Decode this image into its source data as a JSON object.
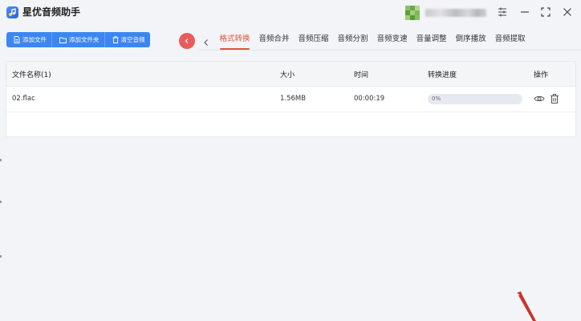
{
  "app": {
    "title": "星优音频助手"
  },
  "toolbar": {
    "add_file": "添加文件",
    "add_folder": "添加文件夹",
    "clear_audio": "清空音频"
  },
  "tabs": [
    {
      "label": "格式转换",
      "active": true
    },
    {
      "label": "音频合并",
      "active": false
    },
    {
      "label": "音频压缩",
      "active": false
    },
    {
      "label": "音频分割",
      "active": false
    },
    {
      "label": "音频变速",
      "active": false
    },
    {
      "label": "音量调整",
      "active": false
    },
    {
      "label": "倒序播放",
      "active": false
    },
    {
      "label": "音频提取",
      "active": false
    }
  ],
  "table": {
    "headers": {
      "name": "文件名称(1)",
      "size": "大小",
      "time": "时间",
      "progress": "转换进度",
      "actions": "操作"
    },
    "rows": [
      {
        "name": "02.flac",
        "size": "1.56MB",
        "time": "00:00:19",
        "progress_text": "0%",
        "progress_value": 0
      }
    ]
  },
  "colors": {
    "accent_blue": "#3b86f2",
    "active_tab": "#e0533f",
    "back_button": "#ea5b5b"
  },
  "icons": [
    "app-logo-icon",
    "avatar",
    "settings-icon",
    "minimize-icon",
    "maximize-icon",
    "close-icon",
    "file-icon",
    "folder-icon",
    "trash-icon",
    "back-icon",
    "chevron-left-icon",
    "eye-icon",
    "delete-icon"
  ]
}
